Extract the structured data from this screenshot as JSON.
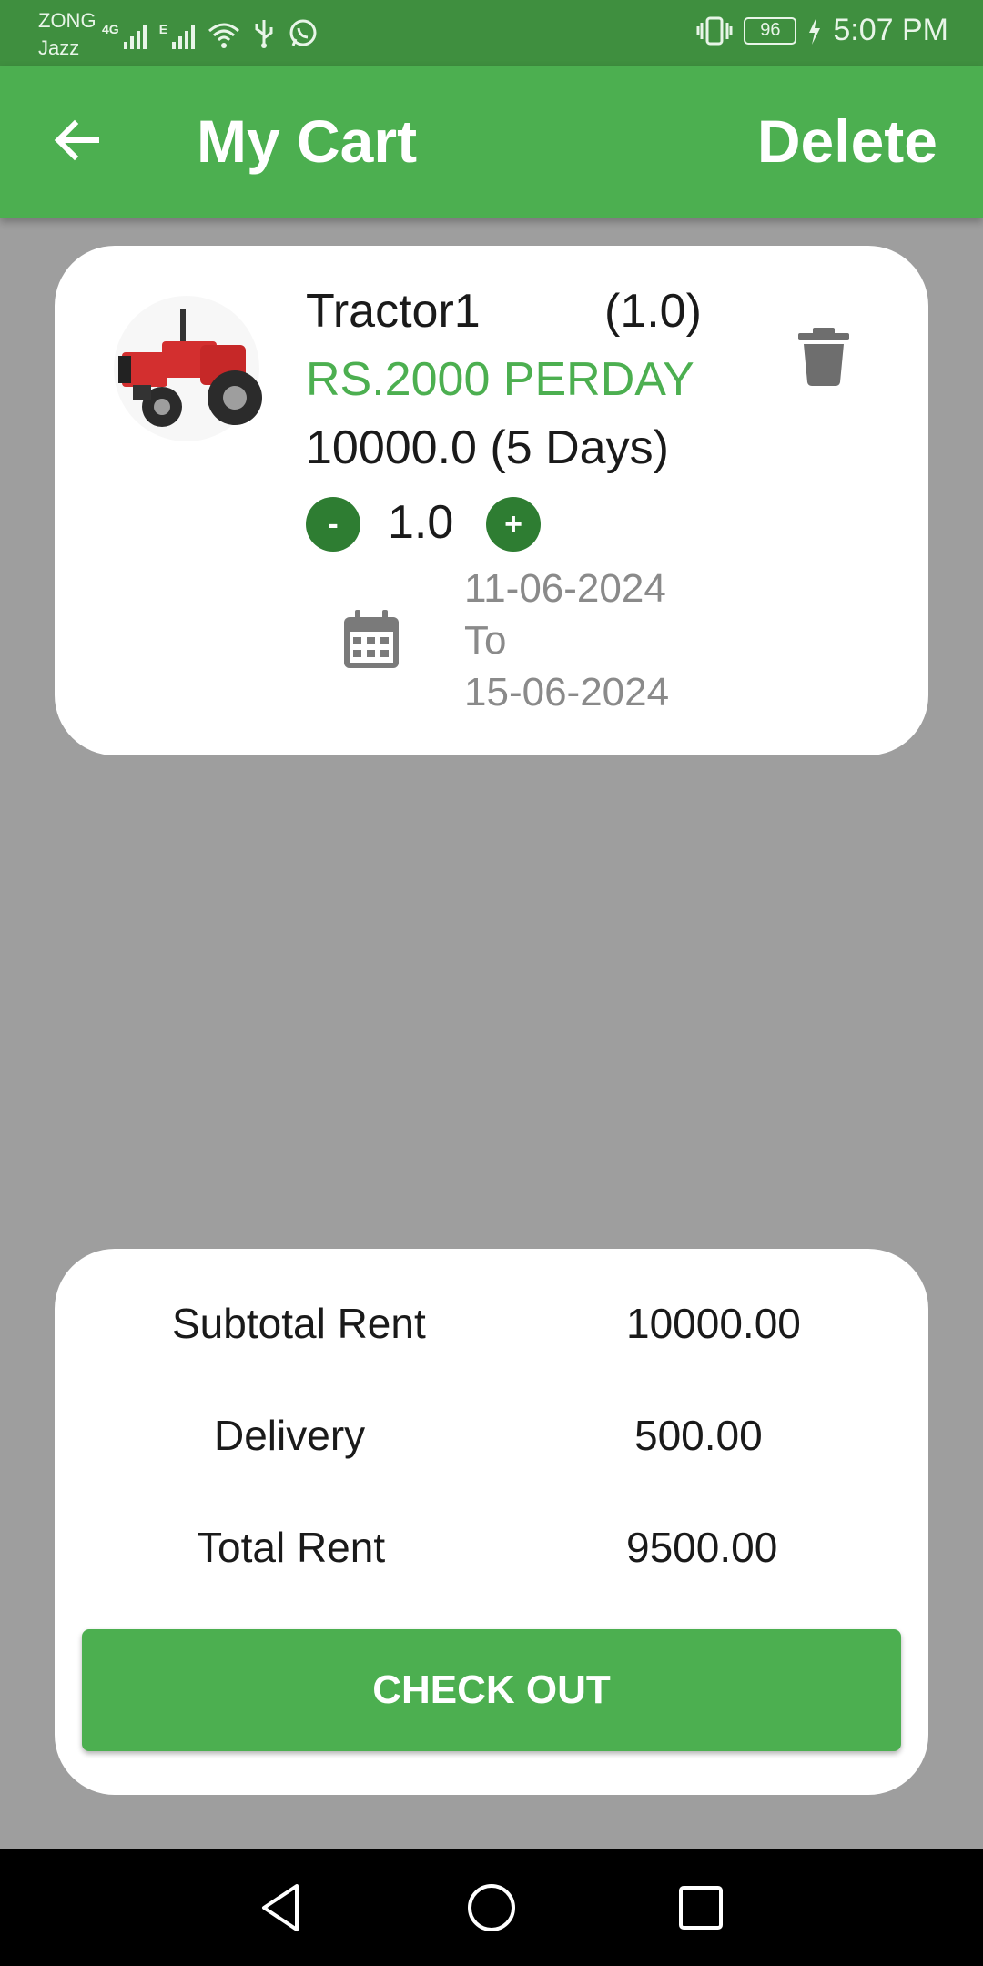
{
  "status_bar": {
    "carrier_top": "ZONG",
    "carrier_bottom": "Jazz",
    "network_4g": "4G",
    "network_e": "E",
    "battery": "96",
    "time": "5:07 PM",
    "icons": [
      "signal-icon",
      "signal-icon",
      "wifi-icon",
      "usb-icon",
      "whatsapp-icon",
      "vibrate-icon",
      "battery-icon",
      "charging-icon"
    ]
  },
  "app_bar": {
    "title": "My Cart",
    "delete_label": "Delete",
    "back_icon": "arrow-left-icon"
  },
  "cart_items": [
    {
      "name": "Tractor1",
      "qty_label": "(1.0)",
      "price": "RS.2000 PERDAY",
      "total": "10000.0 (5 Days)",
      "minus_label": "-",
      "qty": "1.0",
      "plus_label": "+",
      "date_from": "11-06-2024",
      "date_sep": "To",
      "date_to": "15-06-2024",
      "image": "tractor-image",
      "colors": {
        "price": "#4caf50",
        "stepper": "#2e7d32"
      }
    }
  ],
  "summary": {
    "subtotal_label": "Subtotal Rent",
    "subtotal_value": "10000.00",
    "delivery_label": "Delivery",
    "delivery_value": "500.00",
    "total_label": "Total Rent",
    "total_value": "9500.00",
    "checkout_label": "CHECK OUT"
  },
  "nav_bar": {
    "icons": [
      "back-triangle-icon",
      "home-circle-icon",
      "recents-square-icon"
    ]
  },
  "colors": {
    "primary": "#4caf50",
    "status_bar": "#3f8f3f",
    "background": "#9e9e9e"
  }
}
